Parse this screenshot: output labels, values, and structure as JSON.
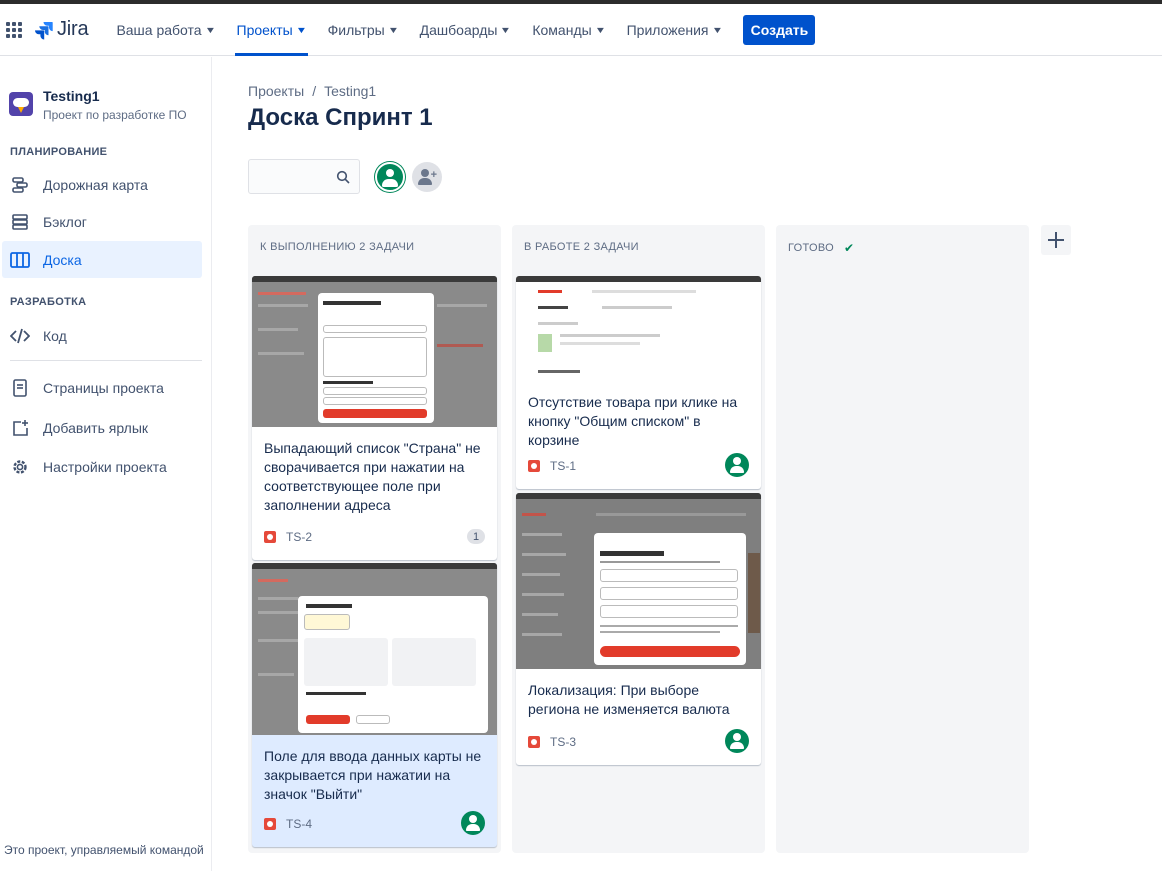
{
  "topnav": {
    "product": "Jira",
    "items": [
      {
        "label": "Ваша работа",
        "active": false
      },
      {
        "label": "Проекты",
        "active": true
      },
      {
        "label": "Фильтры",
        "active": false
      },
      {
        "label": "Дашбоарды",
        "active": false
      },
      {
        "label": "Команды",
        "active": false
      },
      {
        "label": "Приложения",
        "active": false
      }
    ],
    "create_label": "Создать"
  },
  "sidebar": {
    "project_name": "Testing1",
    "project_type": "Проект по разработке ПО",
    "sections": [
      {
        "title": "ПЛАНИРОВАНИЕ",
        "items": [
          "Дорожная карта",
          "Бэклог",
          "Доска"
        ]
      },
      {
        "title": "РАЗРАБОТКА",
        "items": [
          "Код"
        ]
      }
    ],
    "extra_items": [
      "Страницы проекта",
      "Добавить ярлык",
      "Настройки проекта"
    ],
    "footer": "Это проект, управляемый командой"
  },
  "breadcrumb": [
    "Проекты",
    "/",
    "Testing1"
  ],
  "page_title": "Доска Спринт 1",
  "columns": [
    {
      "title": "К ВЫПОЛНЕНИЮ 2 ЗАДАЧИ",
      "cards": [
        {
          "title": "Выпадающий список \"Страна\" не сворачивается при нажатии на соответствующее поле при заполнении адреса",
          "key": "TS-2",
          "comments": "1"
        },
        {
          "title": "Поле для ввода данных карты не закрывается при нажатии на значок \"Выйти\"",
          "key": "TS-4"
        }
      ]
    },
    {
      "title": "В РАБОТЕ 2 ЗАДАЧИ",
      "cards": [
        {
          "title": "Отсутствие товара при клике на кнопку \"Общим списком\" в корзине",
          "key": "TS-1"
        },
        {
          "title": "Локализация: При выборе региона не изменяется валюта",
          "key": "TS-3"
        }
      ]
    },
    {
      "title": "ГОТОВО",
      "cards": []
    }
  ],
  "colors": {
    "accent": "#0052cc",
    "bug": "#e5493a",
    "avatar": "#00875a"
  }
}
